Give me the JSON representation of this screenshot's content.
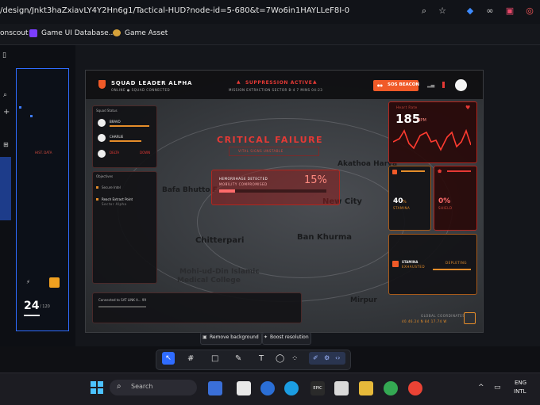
{
  "browser": {
    "url": "/design/Jnkt3haZxiavLY4Y2Hn6g1/Tactical-HUD?node-id=5-680&t=7Wo6in1HAYLLeF8I-0",
    "bookmarks": [
      "onscout",
      "Game UI Database...",
      "Game Asset"
    ],
    "accent_red": "#e53935"
  },
  "left_panel": {
    "frame_small_text": "HIST. DATA",
    "ammo_count": "24",
    "ammo_total": "/ 120"
  },
  "hud": {
    "squad_title": "SQUAD LEADER ALPHA",
    "squad_sub": "ONLINE  ● SQUAD CONNECTED",
    "alert_title": "SUPPRESSION ACTIVE",
    "alert_sub": "MISSION EXTRACTION  SECTOR B-4  7 MINS  04:23",
    "sos_label": "SOS BEACON",
    "sos_prefix": "●●",
    "squad_status_title": "Squad Status",
    "members": [
      {
        "name": "BRAVO",
        "status": ""
      },
      {
        "name": "CHARLIE",
        "status": ""
      },
      {
        "name": "DELTA",
        "status": "DOWN"
      }
    ],
    "objectives_title": "Objectives",
    "objectives": [
      {
        "text": "Secure Intel",
        "sub": ""
      },
      {
        "text": "Reach Extract Point",
        "sub": "Sector Alpha"
      }
    ],
    "critical_title": "CRITICAL FAILURE",
    "critical_sub": "VITAL SIGNS UNSTABLE",
    "hemorrhage_label": "HEMORRHAGE DETECTED",
    "hemorrhage_sub": "MOBILITY COMPROMISED",
    "hemorrhage_percent": "15%",
    "hemorrhage_fill": 0.15,
    "heart_label": "Heart Rate",
    "heart_value": "185",
    "heart_unit": "BPM",
    "stat1_value": "40",
    "stat1_unit": "%",
    "stat1_label": "STAMINA",
    "stat2_value": "0%",
    "stat2_label": "SHIELD",
    "stamina_label": "STAMINA",
    "stamina_value": "EXHAUSTED",
    "stamina_right": "DEPLETING",
    "comms_text": "Connected to SAT LINK  A... 99",
    "coords_title": "GLOBAL COORDINATES",
    "coords_value": "40.46.24 N 84 17.74 W",
    "map_labels": [
      "Akathoa Harya",
      "Bafa Bhutto F",
      "New City",
      "Chitterpari",
      "Ban Khurma",
      "Mohi-ud-Din Islamic",
      "Medical College",
      "Mirpur"
    ]
  },
  "canvas_actions": {
    "remove_bg": "Remove background",
    "boost_res": "Boost resolution"
  },
  "taskbar": {
    "search_placeholder": "Search",
    "lang1": "ENG",
    "lang2": "INTL"
  }
}
